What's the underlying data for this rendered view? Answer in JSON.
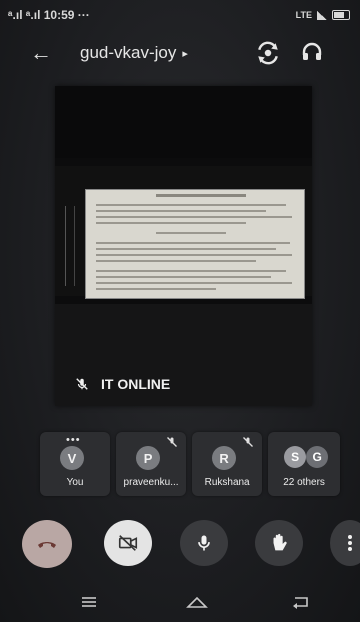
{
  "status_bar": {
    "left_label": "ᵃ.ıl ᵃ.ıl 10:59 ···",
    "right_label": "LTE"
  },
  "top_bar": {
    "meeting_code": "gud-vkav-joy",
    "arrow": "▸"
  },
  "main_tile": {
    "presenter_name": "IT ONLINE"
  },
  "participants": {
    "items": [
      {
        "initial": "V",
        "name": "You"
      },
      {
        "initial": "P",
        "name": "praveenku..."
      },
      {
        "initial": "R",
        "name": "Rukshana"
      }
    ],
    "others": {
      "initial_1": "S",
      "initial_2": "G",
      "label": "22 others"
    }
  },
  "colors": {
    "end_call_bg": "#b9a7a4",
    "camera_bg": "#e4e4e4",
    "control_bg": "#3a3b3e",
    "avatar_bg": "#7a7c80"
  }
}
